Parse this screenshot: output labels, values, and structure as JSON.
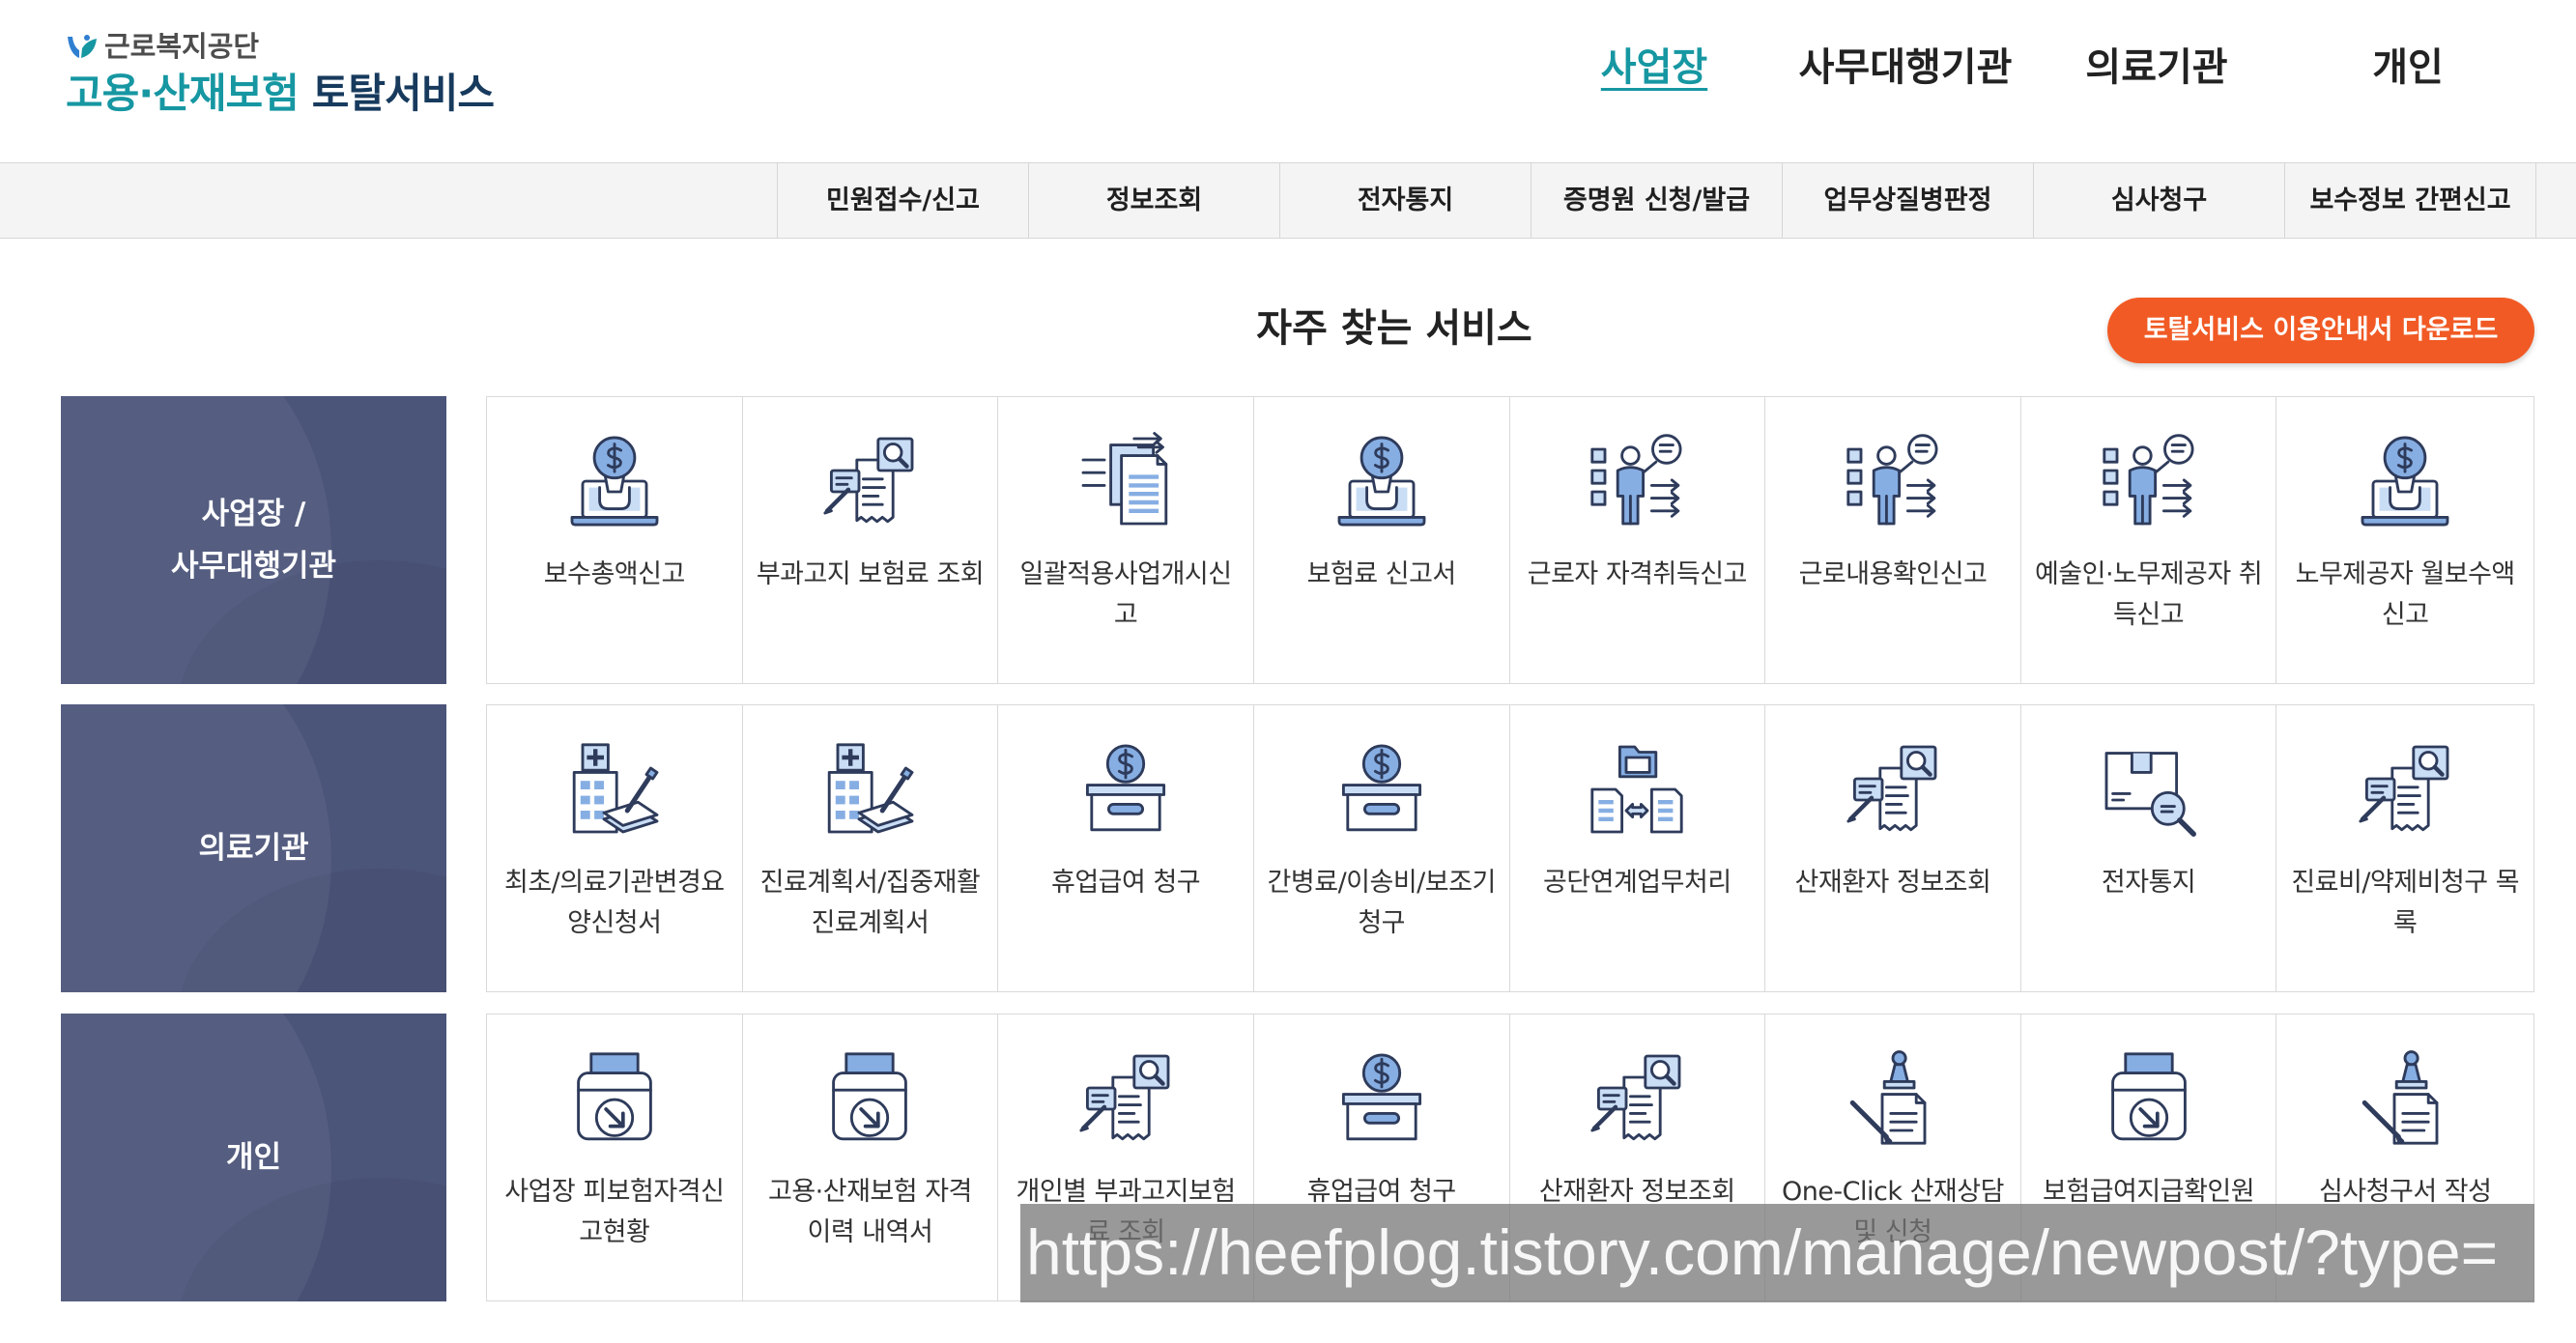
{
  "colors": {
    "teal": "#1697a2",
    "category_bg": "#4b5479",
    "download_button_bg": "#f15a24",
    "icon_stroke": "#2e3b5b",
    "icon_blue": "#86aee3",
    "icon_light": "#c9ddf5"
  },
  "header": {
    "logo": {
      "icon": "logo-mark-icon",
      "org_name": "근로복지공단",
      "title_highlight": "고용·산재보험",
      "title_rest": "토탈서비스"
    },
    "nav": [
      {
        "label": "사업장",
        "active": true
      },
      {
        "label": "사무대행기관",
        "active": false
      },
      {
        "label": "의료기관",
        "active": false
      },
      {
        "label": "개인",
        "active": false
      }
    ]
  },
  "subnav": {
    "items": [
      "민원접수/신고",
      "정보조회",
      "전자통지",
      "증명원 신청/발급",
      "업무상질병판정",
      "심사청구",
      "보수정보 간편신고"
    ]
  },
  "frequent_services": {
    "title": "자주 찾는 서비스",
    "download_button": "토탈서비스 이용안내서 다운로드",
    "rows": [
      {
        "category_lines": [
          "사업장 /",
          "사무대행기관"
        ],
        "items": [
          {
            "label": "보수총액신고",
            "icon": "money-laptop-icon"
          },
          {
            "label": "부과고지 보험료 조회",
            "icon": "bill-search-icon"
          },
          {
            "label": "일괄적용사업개시신고",
            "icon": "doc-arrows-icon"
          },
          {
            "label": "보험료 신고서",
            "icon": "money-laptop-icon"
          },
          {
            "label": "근로자 자격취득신고",
            "icon": "person-board-icon"
          },
          {
            "label": "근로내용확인신고",
            "icon": "person-board-icon"
          },
          {
            "label": "예술인·노무제공자 취득신고",
            "icon": "person-board-icon"
          },
          {
            "label": "노무제공자 월보수액 신고",
            "icon": "money-laptop-icon"
          }
        ]
      },
      {
        "category_lines": [
          "의료기관"
        ],
        "items": [
          {
            "label": "최초/의료기관변경요양신청서",
            "icon": "hospital-pen-icon"
          },
          {
            "label": "진료계획서/집중재활 진료계획서",
            "icon": "hospital-pen-icon"
          },
          {
            "label": "휴업급여 청구",
            "icon": "coin-box-icon"
          },
          {
            "label": "간병료/이송비/보조기 청구",
            "icon": "coin-box-icon"
          },
          {
            "label": "공단연계업무처리",
            "icon": "docs-exchange-icon"
          },
          {
            "label": "산재환자 정보조회",
            "icon": "bill-search-icon"
          },
          {
            "label": "전자통지",
            "icon": "box-search-icon"
          },
          {
            "label": "진료비/약제비청구 목록",
            "icon": "bill-search-icon"
          }
        ]
      },
      {
        "category_lines": [
          "개인"
        ],
        "items": [
          {
            "label": "사업장 피보험자격신고현황",
            "icon": "printer-arrow-icon"
          },
          {
            "label": "고용·산재보험 자격 이력 내역서",
            "icon": "printer-arrow-icon"
          },
          {
            "label": "개인별 부과고지보험료 조회",
            "icon": "bill-search-icon"
          },
          {
            "label": "휴업급여 청구",
            "icon": "coin-box-icon"
          },
          {
            "label": "산재환자 정보조회",
            "icon": "bill-search-icon"
          },
          {
            "label": "One-Click 산재상담 및 신청",
            "icon": "pen-stamp-icon"
          },
          {
            "label": "보험급여지급확인원",
            "icon": "printer-arrow-icon"
          },
          {
            "label": "심사청구서 작성",
            "icon": "pen-stamp-icon"
          }
        ]
      }
    ]
  },
  "url_overlay": "https://heefplog.tistory.com/manage/newpost/?type="
}
